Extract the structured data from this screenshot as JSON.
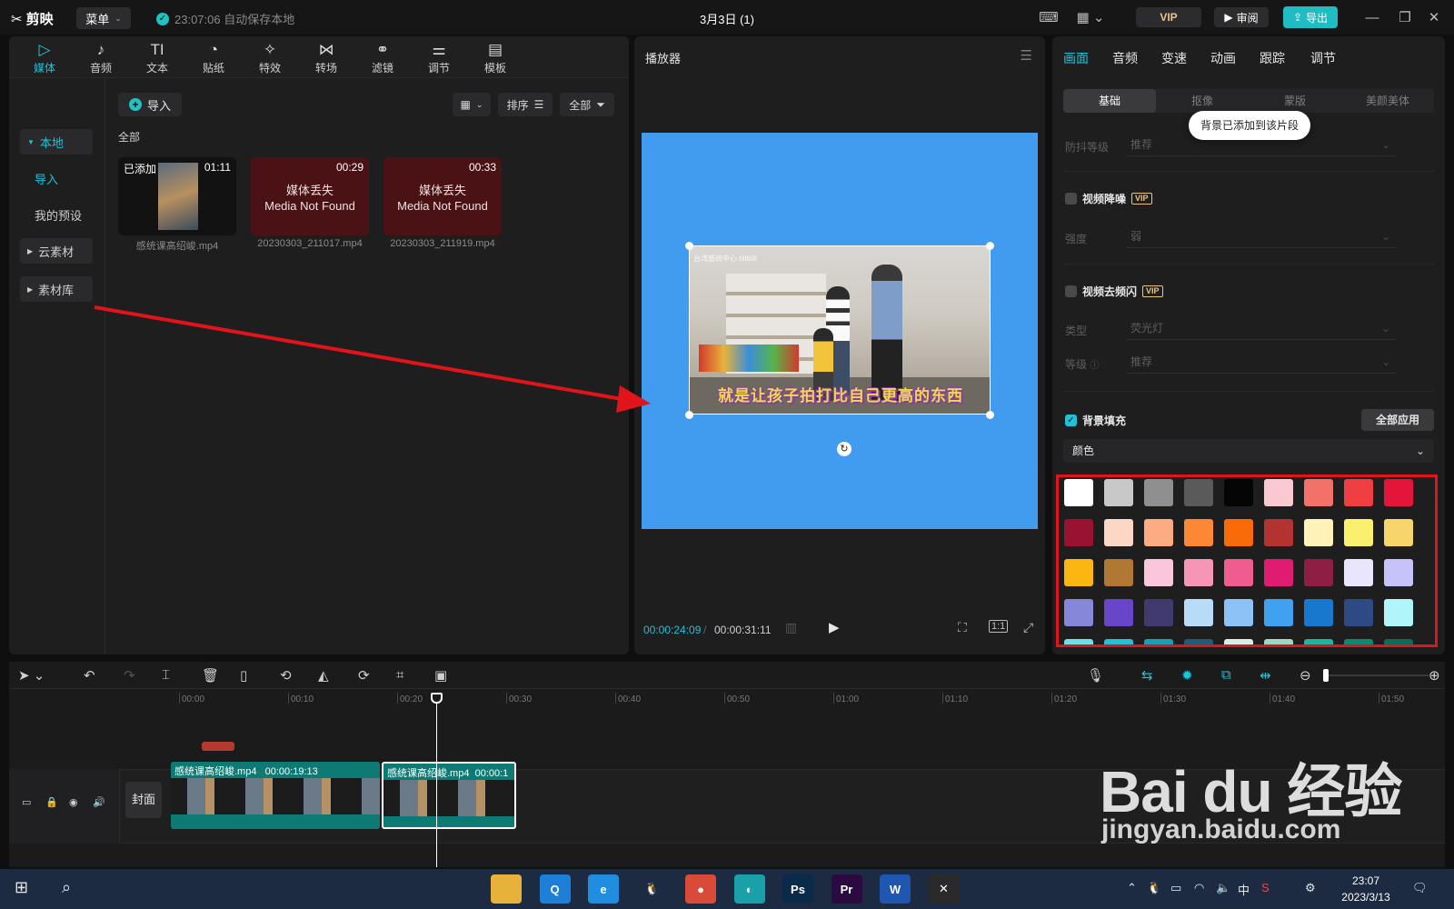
{
  "app": {
    "logo_text": "剪映",
    "menu_label": "菜单",
    "autosave_text": "23:07:06 自动保存本地",
    "project_title": "3月3日 (1)",
    "vip_label": "VIP",
    "review_label": "审阅",
    "export_label": "导出"
  },
  "media_tabs": [
    {
      "icon": "▷",
      "label": "媒体"
    },
    {
      "icon": "♪",
      "label": "音频"
    },
    {
      "icon": "TI",
      "label": "文本"
    },
    {
      "icon": "◔",
      "label": "贴纸"
    },
    {
      "icon": "✧",
      "label": "特效"
    },
    {
      "icon": "⋈",
      "label": "转场"
    },
    {
      "icon": "⚭",
      "label": "滤镜"
    },
    {
      "icon": "⚌",
      "label": "调节"
    },
    {
      "icon": "▤",
      "label": "模板"
    }
  ],
  "sidebar": {
    "local": "本地",
    "import": "导入",
    "my_presets": "我的预设",
    "cloud": "云素材",
    "library": "素材库"
  },
  "media": {
    "import_label": "导入",
    "sort_label": "排序",
    "all_label": "全部",
    "filter_label": "全部",
    "items": [
      {
        "status": "已添加",
        "duration": "01:11",
        "name": "感统课高绍峻.mp4",
        "missing": false,
        "missing_text": ""
      },
      {
        "status": "",
        "duration": "00:29",
        "name": "20230303_211017.mp4",
        "missing": true,
        "missing_text": "媒体丢失\nMedia Not Found"
      },
      {
        "status": "",
        "duration": "00:33",
        "name": "20230303_211919.mp4",
        "missing": true,
        "missing_text": "媒体丢失\nMedia Not Found"
      }
    ],
    "missing_cn": "媒体丢失",
    "missing_en": "Media Not Found"
  },
  "player": {
    "title": "播放器",
    "subtitle_text": "就是让孩子拍打比自己更高的东西",
    "watermark": "台湾感统中心 bilibili",
    "current_time": "00:00:24:09",
    "total_time": "00:00:31:11",
    "ratio_label": "1:1",
    "canvas_color": "#419bee"
  },
  "props": {
    "tabs": [
      "画面",
      "音频",
      "变速",
      "动画",
      "跟踪",
      "调节"
    ],
    "subtabs": [
      "基础",
      "抠像",
      "蒙版",
      "美颜美体"
    ],
    "toast": "背景已添加到该片段",
    "stabilize_label": "防抖等级",
    "stabilize_value": "推荐",
    "denoise_label": "视频降噪",
    "denoise_strength_label": "强度",
    "denoise_strength_value": "弱",
    "deflicker_label": "视频去频闪",
    "deflicker_type_label": "类型",
    "deflicker_type_value": "荧光灯",
    "deflicker_level_label": "等级",
    "deflicker_level_value": "推荐",
    "vip": "VIP",
    "bg_fill_label": "背景填充",
    "apply_all_label": "全部应用",
    "bg_fill_type": "颜色",
    "swatches": [
      "#ffffff",
      "#c8c8c8",
      "#8f8f8f",
      "#5a5a5a",
      "#050505",
      "#f9c9cf",
      "#f2726a",
      "#ef3f43",
      "#e3153a",
      "#991331",
      "#fdd7c6",
      "#fdab82",
      "#fc8836",
      "#f96a08",
      "#b33330",
      "#fdf2b8",
      "#fbef6e",
      "#f8d56a",
      "#fbb612",
      "#b07832",
      "#f9c6db",
      "#f696b5",
      "#ee5c90",
      "#df1c72",
      "#8e1e44",
      "#e9e5fc",
      "#c6c3fb",
      "#8787da",
      "#6946c9",
      "#413a6f",
      "#b7dcf7",
      "#8cc2f6",
      "#3fa1ef",
      "#1878cc",
      "#2d4a84",
      "#b0f6f8",
      "#6de0e7",
      "#23c1d6",
      "#1aa0b5",
      "#235a74",
      "#d6efe4",
      "#9fd7c3",
      "#1db59c",
      "#108870",
      "#0f6b55"
    ]
  },
  "timeline": {
    "ruler": [
      "00:00",
      "00:10",
      "00:20",
      "00:30",
      "00:40",
      "00:50",
      "01:00",
      "01:10",
      "01:20",
      "01:30",
      "01:40",
      "01:50"
    ],
    "cover_label": "封面",
    "clips": [
      {
        "label": "感统课高绍峻.mp4",
        "duration": "00:00:19:13"
      },
      {
        "label": "感统课高绍峻.mp4",
        "duration": "00:00:1"
      }
    ]
  },
  "watermark": {
    "brand": "Bai du 经验",
    "url": "jingyan.baidu.com"
  },
  "taskbar": {
    "apps": [
      {
        "icon": "folder-icon",
        "text": "",
        "color": "#e8b13a"
      },
      {
        "icon": "q-icon",
        "text": "Q",
        "color": "#1d7fd8"
      },
      {
        "icon": "edge-old-icon",
        "text": "e",
        "color": "#1f8de0"
      },
      {
        "icon": "qq-icon",
        "text": "🐧",
        "color": "#1c2a42"
      },
      {
        "icon": "chrome-icon",
        "text": "●",
        "color": "#d94a38"
      },
      {
        "icon": "edge-icon",
        "text": "◐",
        "color": "#1aa0a8"
      },
      {
        "icon": "photoshop-icon",
        "text": "Ps",
        "color": "#0a2a4a"
      },
      {
        "icon": "premiere-icon",
        "text": "Pr",
        "color": "#2a0a40"
      },
      {
        "icon": "word-icon",
        "text": "W",
        "color": "#1e56b0"
      },
      {
        "icon": "capcut-icon",
        "text": "✕",
        "color": "#2a2a2a"
      }
    ],
    "ime": "中",
    "time": "23:07",
    "date": "2023/3/13"
  }
}
